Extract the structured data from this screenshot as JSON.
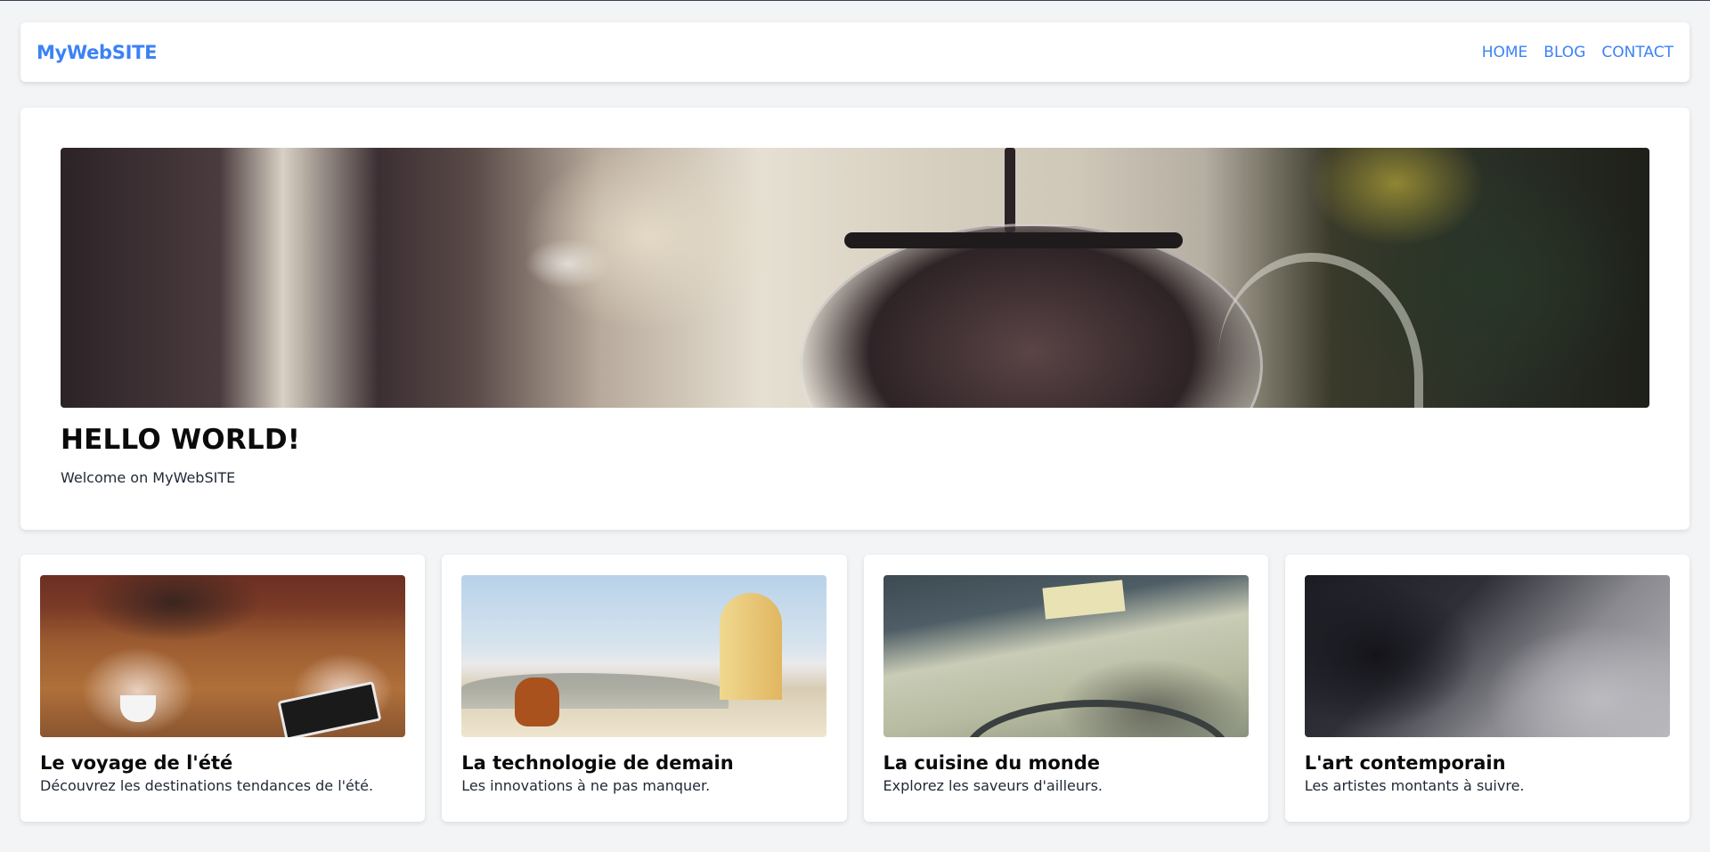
{
  "header": {
    "logo": "MyWebSITE",
    "nav": [
      {
        "label": "HOME"
      },
      {
        "label": "BLOG"
      },
      {
        "label": "CONTACT"
      }
    ]
  },
  "hero": {
    "title": "HELLO WORLD!",
    "subtitle": "Welcome on MyWebSITE"
  },
  "cards": [
    {
      "title": "Le voyage de l'été",
      "description": "Découvrez les destinations tendances de l'été."
    },
    {
      "title": "La technologie de demain",
      "description": "Les innovations à ne pas manquer."
    },
    {
      "title": "La cuisine du monde",
      "description": "Explorez les saveurs d'ailleurs."
    },
    {
      "title": "L'art contemporain",
      "description": "Les artistes montants à suivre."
    }
  ],
  "colors": {
    "accent": "#3b82f6",
    "background": "#f3f4f6",
    "card": "#ffffff"
  }
}
